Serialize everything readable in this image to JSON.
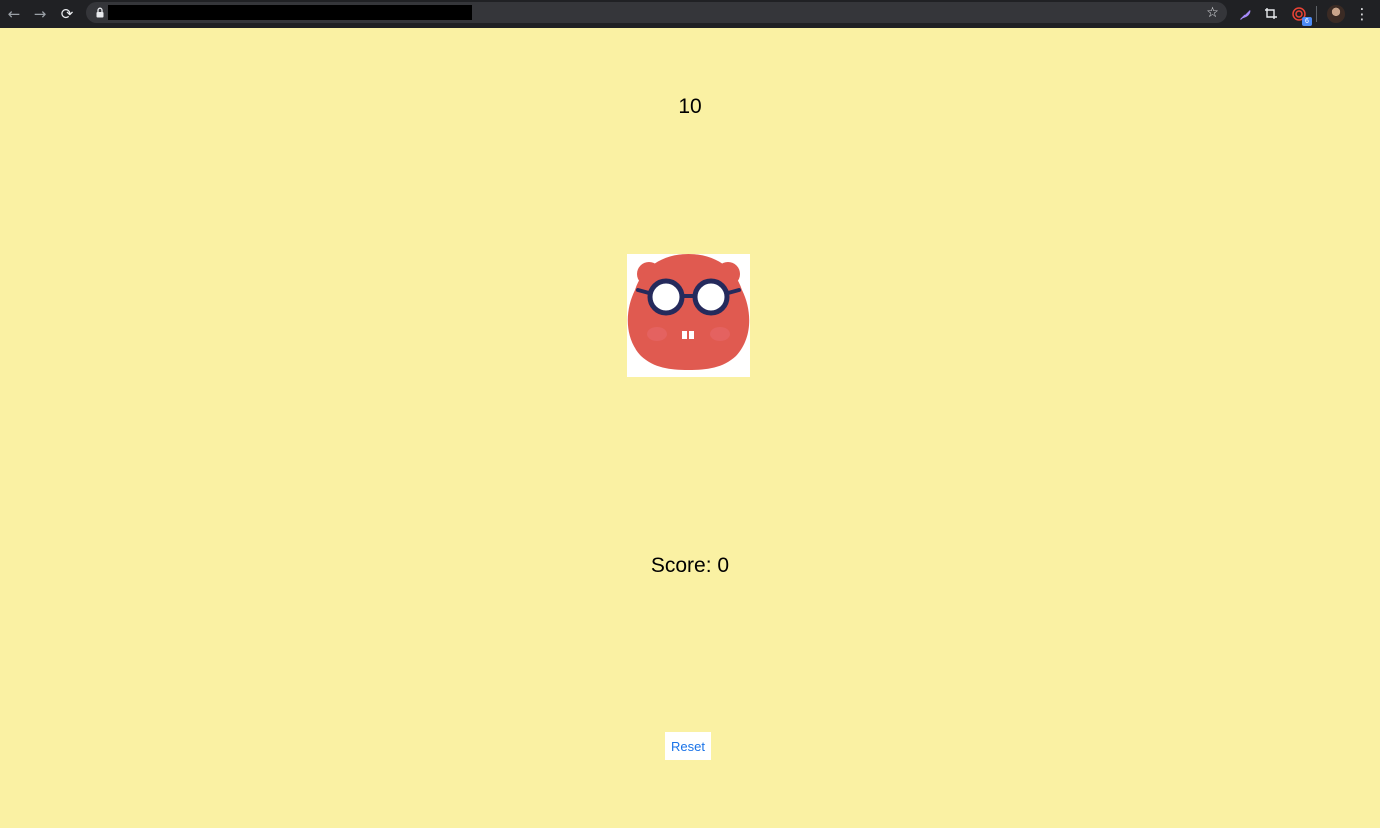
{
  "browser": {
    "back_glyph": "←",
    "forward_glyph": "→",
    "reload_glyph": "⟳",
    "url": "",
    "bookmark_glyph": "☆",
    "extensions": [
      {
        "name": "feather-extension-icon",
        "color": "#a78bfa"
      },
      {
        "name": "crop-extension-icon",
        "color": "#e8eaed"
      },
      {
        "name": "target-extension-icon",
        "color": "#ea4335",
        "badge": "6"
      }
    ],
    "menu_glyph": "⋮"
  },
  "game": {
    "timer": "10",
    "score_label": "Score:",
    "score_value": "0",
    "reset_label": "Reset"
  },
  "colors": {
    "background": "#faf1a3",
    "mole": "#e05a50",
    "glasses": "#252a5c",
    "link": "#1a73e8"
  }
}
